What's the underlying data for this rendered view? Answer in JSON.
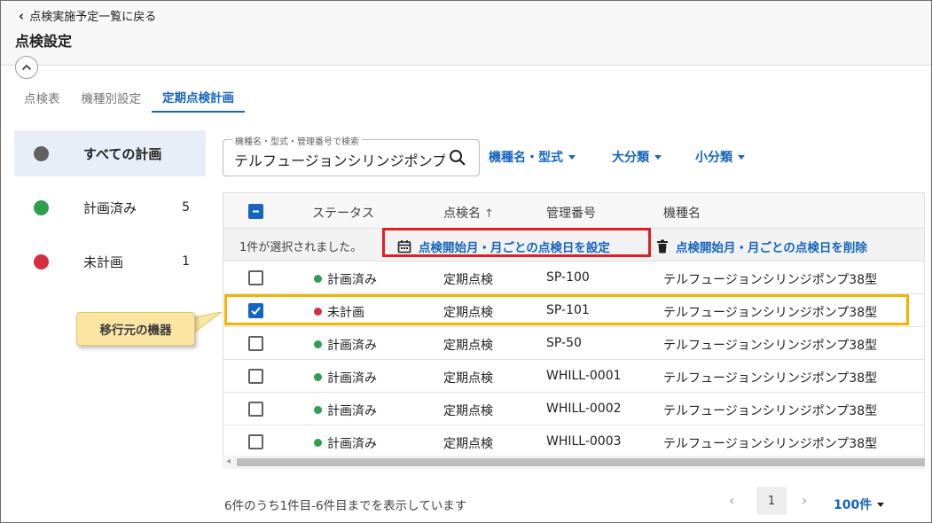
{
  "header": {
    "back_label": "点検実施予定一覧に戻る",
    "title": "点検設定",
    "collapse_icon": "chevron-up-icon"
  },
  "tabs": [
    {
      "label": "点検表",
      "active": false
    },
    {
      "label": "機種別設定",
      "active": false
    },
    {
      "label": "定期点検計画",
      "active": true
    }
  ],
  "sidebar": {
    "items": [
      {
        "label": "すべての計画",
        "count": "",
        "dot_color": "#616161",
        "active": true
      },
      {
        "label": "計画済み",
        "count": "5",
        "dot_color": "#2e9e4f",
        "active": false
      },
      {
        "label": "未計画",
        "count": "1",
        "dot_color": "#d32f3f",
        "active": false
      }
    ]
  },
  "callout": {
    "label": "移行元の機器"
  },
  "search": {
    "label": "機種名・型式・管理番号で検索",
    "value": "テルフュージョンシリンジポンプ"
  },
  "filters": [
    {
      "label": "機種名・型式"
    },
    {
      "label": "大分類"
    },
    {
      "label": "小分類"
    }
  ],
  "table": {
    "columns": {
      "status": "ステータス",
      "inspection": "点検名",
      "sort_icon": "↑",
      "mgmt_no": "管理番号",
      "model": "機種名"
    },
    "selection_text": "1件が選択されました。",
    "actions": {
      "set": "点検開始月・月ごとの点検日を設定",
      "delete": "点検開始月・月ごとの点検日を削除"
    },
    "rows": [
      {
        "checked": false,
        "status": "計画済み",
        "status_color": "#2e9e4f",
        "inspection": "定期点検",
        "mgmt_no": "SP-100",
        "model": "テルフュージョンシリンジポンプ38型"
      },
      {
        "checked": true,
        "status": "未計画",
        "status_color": "#d32f3f",
        "inspection": "定期点検",
        "mgmt_no": "SP-101",
        "model": "テルフュージョンシリンジポンプ38型"
      },
      {
        "checked": false,
        "status": "計画済み",
        "status_color": "#2e9e4f",
        "inspection": "定期点検",
        "mgmt_no": "SP-50",
        "model": "テルフュージョンシリンジポンプ38型"
      },
      {
        "checked": false,
        "status": "計画済み",
        "status_color": "#2e9e4f",
        "inspection": "定期点検",
        "mgmt_no": "WHILL-0001",
        "model": "テルフュージョンシリンジポンプ38型"
      },
      {
        "checked": false,
        "status": "計画済み",
        "status_color": "#2e9e4f",
        "inspection": "定期点検",
        "mgmt_no": "WHILL-0002",
        "model": "テルフュージョンシリンジポンプ38型"
      },
      {
        "checked": false,
        "status": "計画済み",
        "status_color": "#2e9e4f",
        "inspection": "定期点検",
        "mgmt_no": "WHILL-0003",
        "model": "テルフュージョンシリンジポンプ38型"
      }
    ]
  },
  "footer": {
    "range_text": "6件のうち1件目-6件目までを表示しています",
    "prev_icon": "‹",
    "current_page": "1",
    "next_icon": "›",
    "per_page": "100件"
  },
  "colors": {
    "accent": "#1565c0",
    "highlight_red": "#e02020",
    "highlight_yellow": "#f4b400"
  }
}
